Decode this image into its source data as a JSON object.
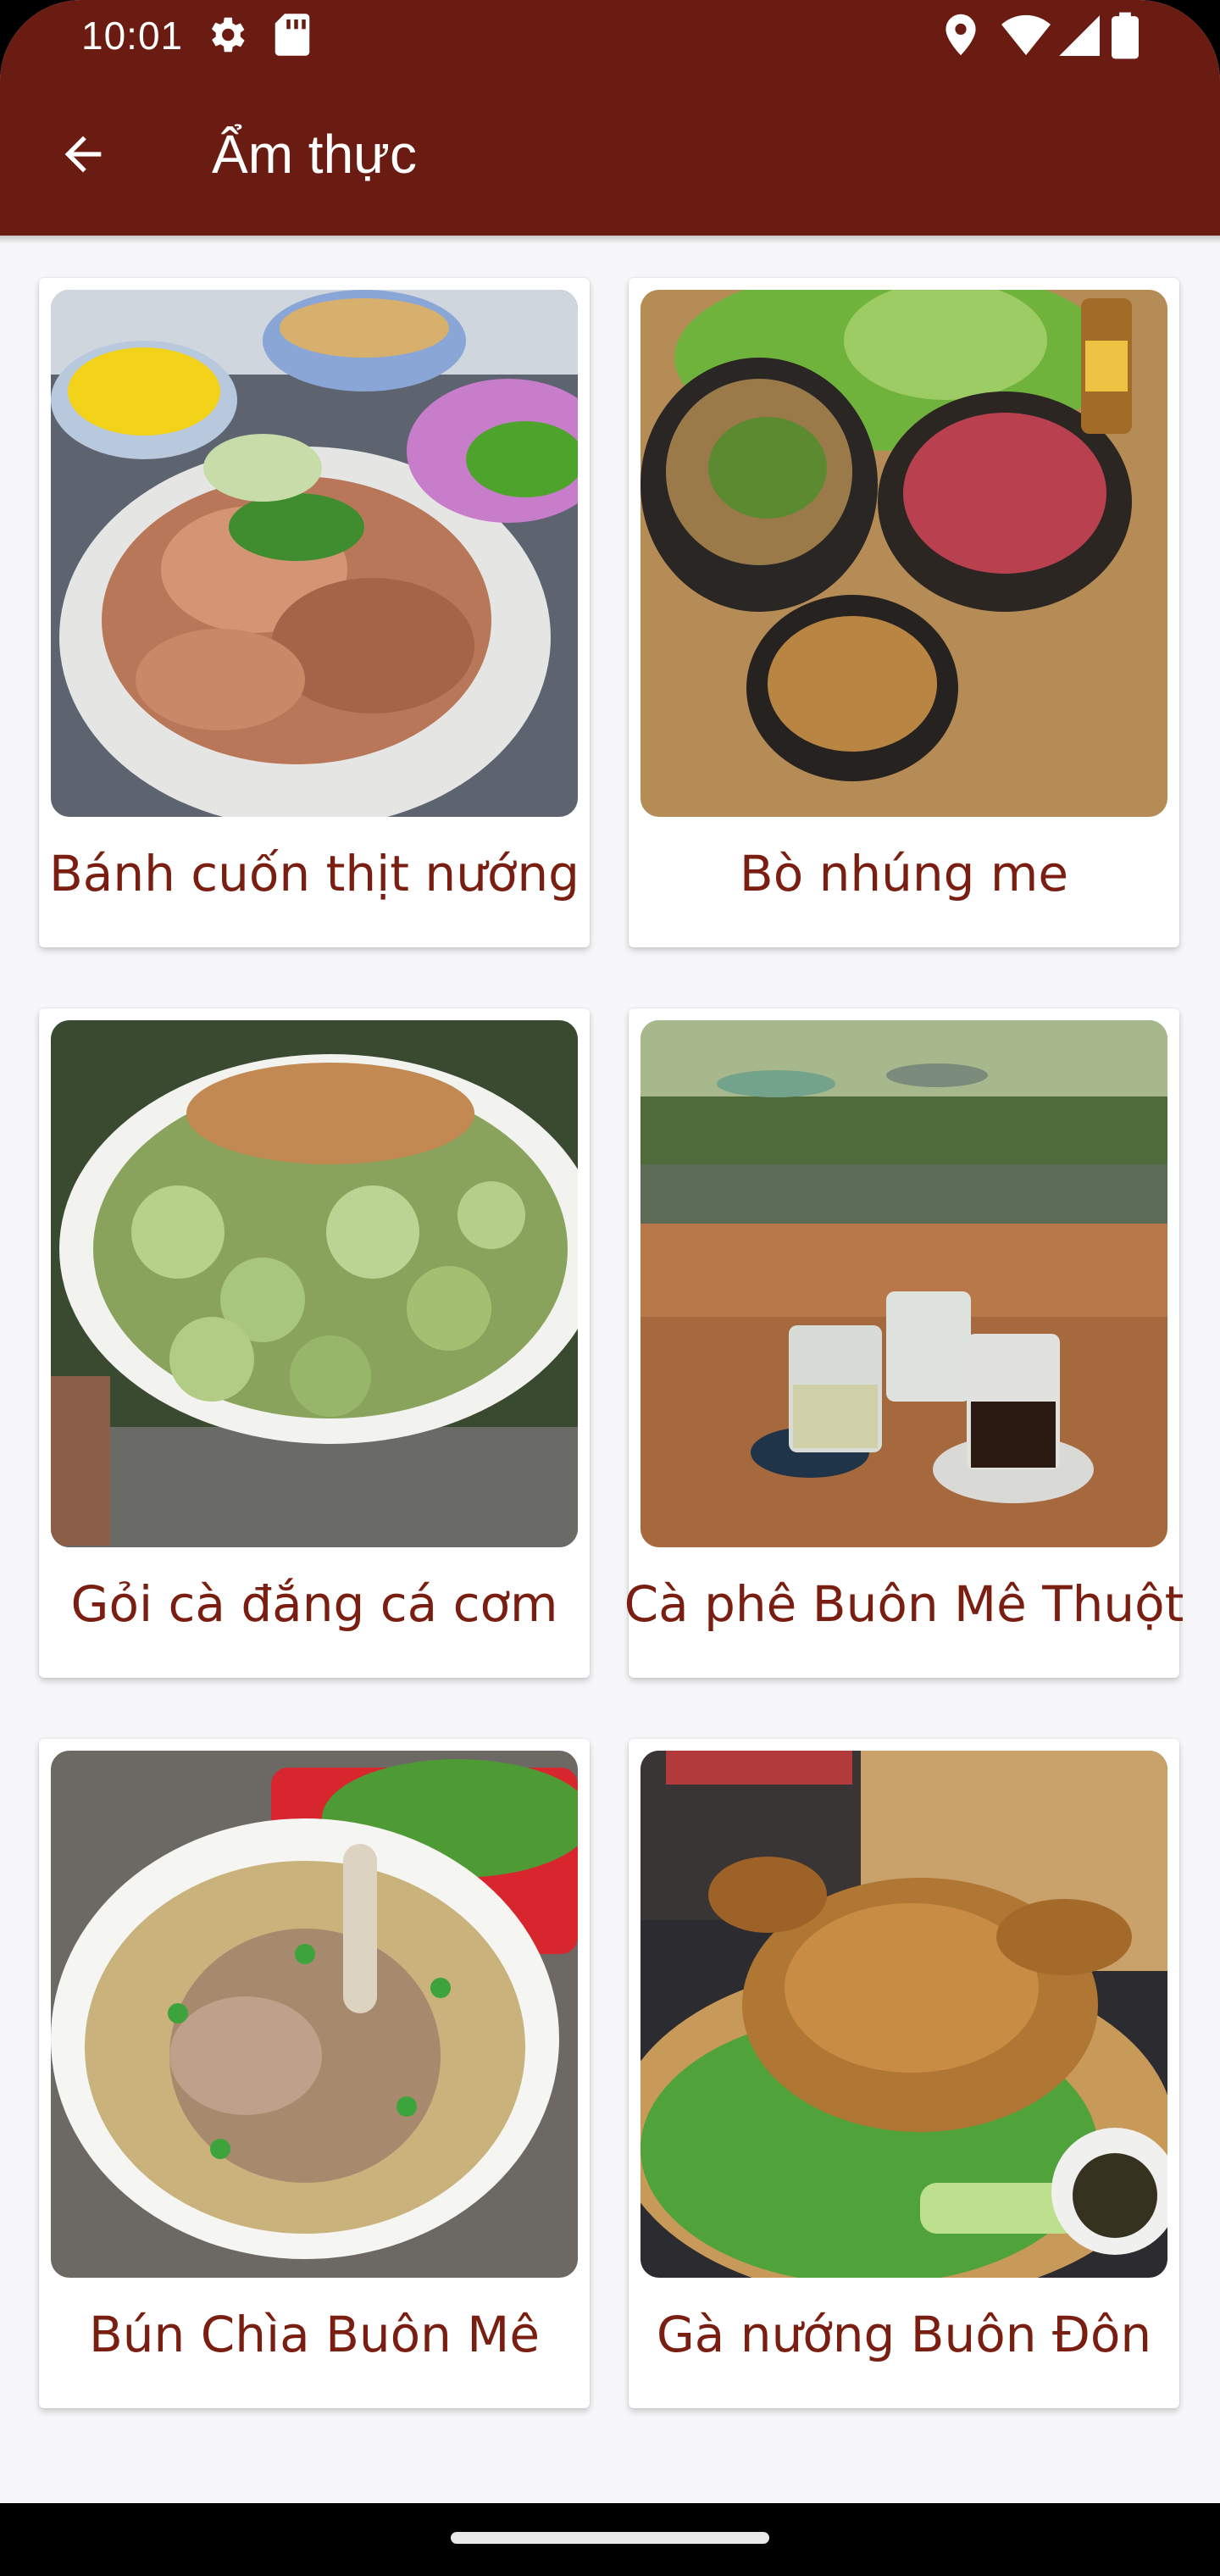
{
  "status_bar": {
    "time": "10:01",
    "left_icons": [
      "gear-icon",
      "sd-card-icon"
    ],
    "right_icons": [
      "location-icon",
      "wifi-icon",
      "signal-icon",
      "battery-icon"
    ]
  },
  "app_bar": {
    "title": "Ẩm thực",
    "back_icon": "arrow-left-icon",
    "color": "#6b1c12"
  },
  "dishes": [
    {
      "name": "Bánh cuốn thịt nướng"
    },
    {
      "name": "Bò nhúng me"
    },
    {
      "name": "Gỏi cà đắng cá cơm"
    },
    {
      "name": "Cà phê Buôn Mê Thuột"
    },
    {
      "name": "Bún Chìa Buôn Mê"
    },
    {
      "name": "Gà nướng Buôn Đôn"
    }
  ],
  "colors": {
    "label_text": "#7a1e12",
    "background": "#f7f7f9"
  }
}
